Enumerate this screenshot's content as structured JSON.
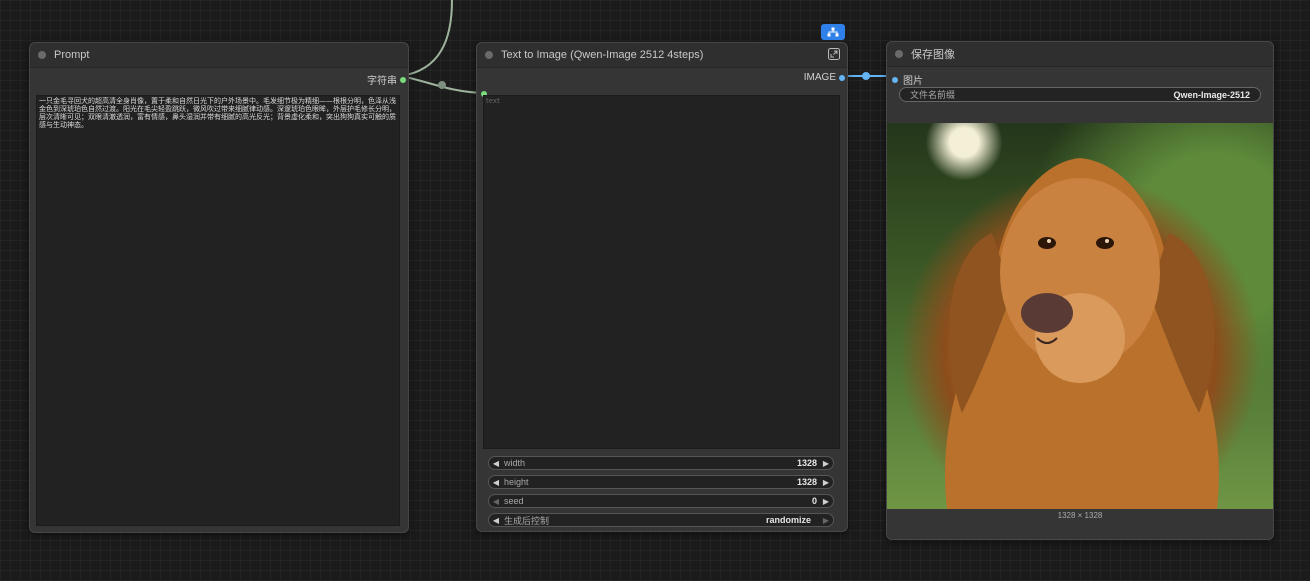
{
  "nodes": {
    "prompt": {
      "title": "Prompt",
      "output_label": "字符串",
      "text": "一只金毛寻回犬的超高清全身肖像，置于柔和自然日光下的户外场景中。毛发细节极为精细——根根分明，色泽从浅金色到深琥珀色自然过渡。阳光在毛尖轻盈跳跃，微风吹过带来细腻律动感。深邃琥珀色眼眸，外层护毛修长分明，层次清晰可见；双眼清澈透润，富有情感，鼻头湿润并带有细腻的高光反光；背景虚化柔和，突出狗狗真实可触的质感与生动神态。"
    },
    "t2i": {
      "title": "Text to Image (Qwen-Image 2512 4steps)",
      "output_label": "IMAGE",
      "text_placeholder": "text",
      "widgets": [
        {
          "label": "width",
          "value": "1328"
        },
        {
          "label": "height",
          "value": "1328"
        },
        {
          "label": "seed",
          "value": "0"
        },
        {
          "label": "生成后控制",
          "value": "randomize"
        }
      ],
      "badge_icon": "subgraph-icon",
      "expand_icon": "expand-icon"
    },
    "save": {
      "title": "保存图像",
      "input_label": "图片",
      "prefix_label": "文件名前缀",
      "prefix_value": "Qwen-Image-2512",
      "image_size": "1328 × 1328"
    }
  },
  "colors": {
    "canvas": "#1b1b1b",
    "node_bg": "#353535",
    "string_slot": "#7bdc7b",
    "image_slot": "#64b5f6",
    "badge": "#2f80e9"
  }
}
